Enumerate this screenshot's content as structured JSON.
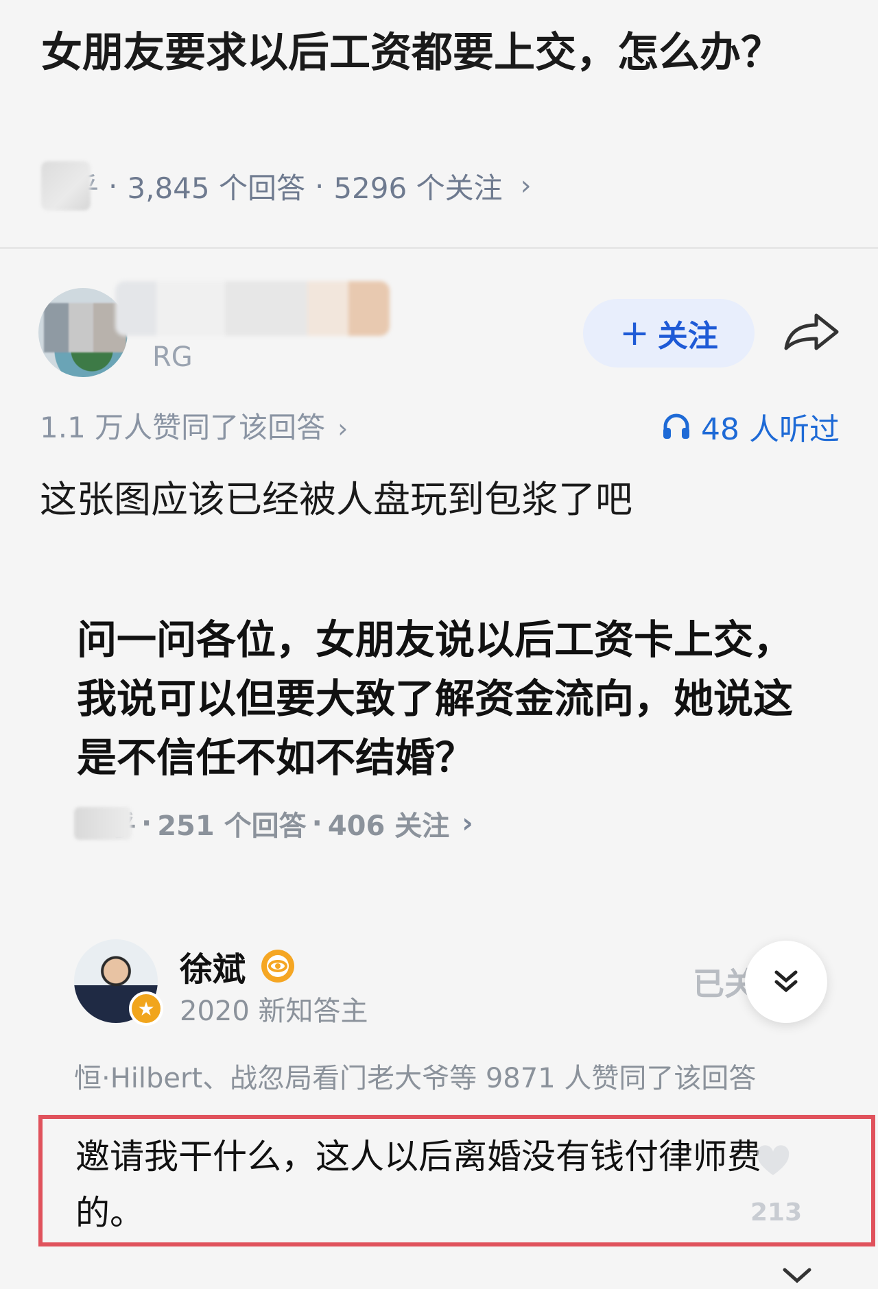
{
  "question": {
    "title": "女朋友要求以后工资都要上交，怎么办？",
    "source_fragment": "乎",
    "answers": "3,845 个回答",
    "followers": "5296 个关注",
    "separator": "·"
  },
  "answer": {
    "author_badge": "RG",
    "follow_label": "关注",
    "follow_plus": "+",
    "votes_text": "1.1 万人赞同了该回答",
    "listened_text": "48 人听过",
    "body": "这张图应该已经被人盘玩到包浆了吧"
  },
  "embed": {
    "question": "问一问各位，女朋友说以后工资卡上交，我说可以但要大致了解资金流向，她说这是不信任不如不结婚？",
    "meta_source_fragment": "乎",
    "meta_answers": "251 个回答",
    "meta_followers": "406 关注",
    "separator": "·",
    "author_name": "徐斌",
    "author_title": "2020 新知答主",
    "followed_label": "已关",
    "votes_text": "恒·Hilbert、战忽局看门老大爷等 9871 人赞同了该回答",
    "reply": "邀请我干什么，这人以后离婚没有钱付律师费的。",
    "like_count": "213"
  },
  "colors": {
    "accent_blue": "#1e5ad6",
    "highlight_red": "#e0525c",
    "meta_gray": "#6e7a8f"
  },
  "icons": {
    "share": "share-arrow-icon",
    "headphone": "headphone-icon",
    "chevron": "chevron-right-icon",
    "collapse": "double-chevron-down-icon",
    "verified": "verified-badge-icon",
    "like": "heart-icon"
  }
}
